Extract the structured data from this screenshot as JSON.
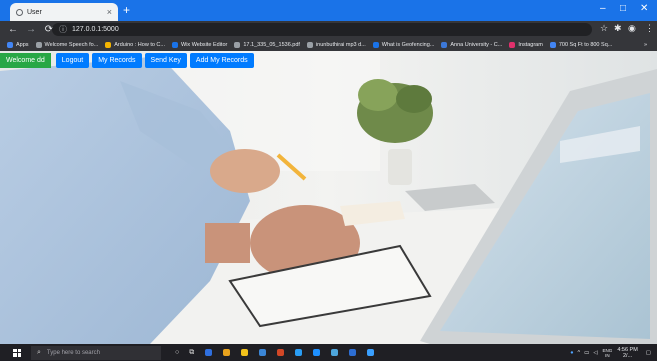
{
  "browser": {
    "tab_title": "User",
    "tab_close": "×",
    "new_tab": "+",
    "window_controls": [
      "–",
      "□",
      "✕"
    ],
    "nav_icons": [
      "arrow-left-icon",
      "arrow-right-icon",
      "reload-icon"
    ],
    "url": "127.0.0.1:5000",
    "bookmarks": [
      {
        "label": "Apps",
        "color": "#4285f4"
      },
      {
        "label": "Welcome Speech fo...",
        "color": "#9aa0a6"
      },
      {
        "label": "Arduino : How to C...",
        "color": "#f4b400"
      },
      {
        "label": "Wix Website Editor",
        "color": "#1a73e8"
      },
      {
        "label": "17.1_335_05_1536.pdf",
        "color": "#9aa0a6"
      },
      {
        "label": "inunbuthirai mp3 d...",
        "color": "#9aa0a6"
      },
      {
        "label": "What is Geofencing...",
        "color": "#1a73e8"
      },
      {
        "label": "Anna University - C...",
        "color": "#3c78d8"
      },
      {
        "label": "Instagram",
        "color": "#e1306c"
      },
      {
        "label": "700 Sq Ft to 800 Sq...",
        "color": "#4285f4"
      }
    ],
    "more_bookmarks": "»"
  },
  "navbar": {
    "welcome": "Welcome dd",
    "buttons": [
      "Logout",
      "My Records",
      "Send Key",
      "Add My Records"
    ]
  },
  "taskbar": {
    "search_placeholder": "Type here to search",
    "apps": [
      "#2f6fde",
      "#e8a21d",
      "#f2c21b",
      "#3b86d6",
      "#d24726",
      "#2a9df4",
      "#1e90ff",
      "#4ea6dc",
      "#2d6ed3",
      "#3aa0ff"
    ],
    "language": "ENG",
    "language_sub": "IN",
    "time": "4:56 PM",
    "date": "2/..."
  }
}
